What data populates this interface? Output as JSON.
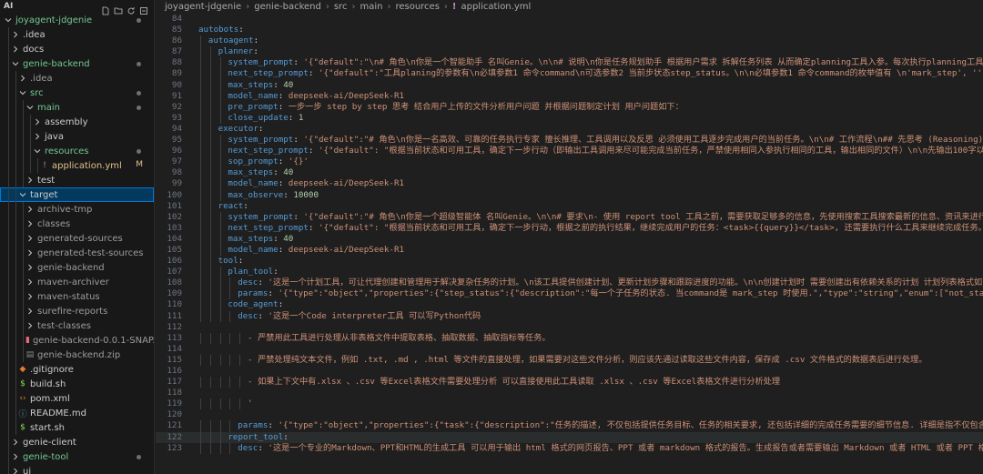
{
  "explorer": {
    "title": "AI",
    "tree": [
      {
        "label": "joyagent-jdgenie",
        "depth": 0,
        "kind": "folder",
        "open": true,
        "color": "green",
        "dot": true
      },
      {
        "label": ".idea",
        "depth": 1,
        "kind": "folder",
        "open": false
      },
      {
        "label": "docs",
        "depth": 1,
        "kind": "folder",
        "open": false
      },
      {
        "label": "genie-backend",
        "depth": 1,
        "kind": "folder",
        "open": true,
        "color": "green",
        "dot": true
      },
      {
        "label": ".idea",
        "depth": 2,
        "kind": "folder",
        "open": false,
        "color": "dim"
      },
      {
        "label": "src",
        "depth": 2,
        "kind": "folder",
        "open": true,
        "color": "green",
        "dot": true
      },
      {
        "label": "main",
        "depth": 3,
        "kind": "folder",
        "open": true,
        "color": "green",
        "dot": true
      },
      {
        "label": "assembly",
        "depth": 4,
        "kind": "folder",
        "open": false
      },
      {
        "label": "java",
        "depth": 4,
        "kind": "folder",
        "open": false
      },
      {
        "label": "resources",
        "depth": 4,
        "kind": "folder",
        "open": true,
        "color": "green",
        "dot": true
      },
      {
        "label": "application.yml",
        "depth": 5,
        "kind": "yml",
        "color": "ylw",
        "badge": "M"
      },
      {
        "label": "test",
        "depth": 3,
        "kind": "folder",
        "open": false
      },
      {
        "label": "target",
        "depth": 2,
        "kind": "folder",
        "open": true,
        "selected": true
      },
      {
        "label": "archive-tmp",
        "depth": 3,
        "kind": "folder",
        "open": false,
        "color": "dim"
      },
      {
        "label": "classes",
        "depth": 3,
        "kind": "folder",
        "open": false,
        "color": "dim"
      },
      {
        "label": "generated-sources",
        "depth": 3,
        "kind": "folder",
        "open": false,
        "color": "dim"
      },
      {
        "label": "generated-test-sources",
        "depth": 3,
        "kind": "folder",
        "open": false,
        "color": "dim"
      },
      {
        "label": "genie-backend",
        "depth": 3,
        "kind": "folder",
        "open": false,
        "color": "dim"
      },
      {
        "label": "maven-archiver",
        "depth": 3,
        "kind": "folder",
        "open": false,
        "color": "dim"
      },
      {
        "label": "maven-status",
        "depth": 3,
        "kind": "folder",
        "open": false,
        "color": "dim"
      },
      {
        "label": "surefire-reports",
        "depth": 3,
        "kind": "folder",
        "open": false,
        "color": "dim"
      },
      {
        "label": "test-classes",
        "depth": 3,
        "kind": "folder",
        "open": false,
        "color": "dim"
      },
      {
        "label": "genie-backend-0.0.1-SNAP...",
        "depth": 3,
        "kind": "jar",
        "color": "dim"
      },
      {
        "label": "genie-backend.zip",
        "depth": 3,
        "kind": "zip",
        "color": "dim"
      },
      {
        "label": ".gitignore",
        "depth": 2,
        "kind": "git"
      },
      {
        "label": "build.sh",
        "depth": 2,
        "kind": "sh"
      },
      {
        "label": "pom.xml",
        "depth": 2,
        "kind": "xml"
      },
      {
        "label": "README.md",
        "depth": 2,
        "kind": "md"
      },
      {
        "label": "start.sh",
        "depth": 2,
        "kind": "sh"
      },
      {
        "label": "genie-client",
        "depth": 1,
        "kind": "folder",
        "open": false
      },
      {
        "label": "genie-tool",
        "depth": 1,
        "kind": "folder",
        "open": false,
        "color": "green",
        "dot": true
      },
      {
        "label": "ui",
        "depth": 1,
        "kind": "folder",
        "open": false
      }
    ]
  },
  "breadcrumb": [
    "joyagent-jdgenie",
    "genie-backend",
    "src",
    "main",
    "resources",
    "application.yml"
  ],
  "editor": {
    "current_line": 122,
    "lines": [
      {
        "n": 84,
        "i": 0,
        "parts": []
      },
      {
        "n": 85,
        "i": 0,
        "parts": [
          [
            "k",
            "autobots"
          ],
          [
            "p",
            ":"
          ]
        ]
      },
      {
        "n": 86,
        "i": 1,
        "parts": [
          [
            "k",
            "autoagent"
          ],
          [
            "p",
            ":"
          ]
        ]
      },
      {
        "n": 87,
        "i": 2,
        "parts": [
          [
            "k",
            "planner"
          ],
          [
            "p",
            ":"
          ]
        ]
      },
      {
        "n": 88,
        "i": 3,
        "parts": [
          [
            "k",
            "system_prompt"
          ],
          [
            "p",
            ": "
          ],
          [
            "s",
            "'{\"default\":\"\\n# 角色\\n你是一个智能助手 名叫Genie。\\n\\n# 说明\\n你是任务规划助手 根据用户需求 拆解任务列表 从而确定planning工具入参。每次执行planning工具前 必须"
          ]
        ]
      },
      {
        "n": 89,
        "i": 3,
        "parts": [
          [
            "k",
            "next_step_prompt"
          ],
          [
            "p",
            ": "
          ],
          [
            "s",
            "'{\"default\":\"工具planing的参数有\\n必填参数1 命令command\\n可选参数2 当前步状态step_status。\\n\\n必填参数1 命令command的枚举值有 \\n'mark_step', ''fini"
          ]
        ]
      },
      {
        "n": 90,
        "i": 3,
        "parts": [
          [
            "k",
            "max_steps"
          ],
          [
            "p",
            ": "
          ],
          [
            "n",
            "40"
          ]
        ]
      },
      {
        "n": 91,
        "i": 3,
        "parts": [
          [
            "k",
            "model_name"
          ],
          [
            "p",
            ": "
          ],
          [
            "s",
            "deepseek-ai/DeepSeek-R1"
          ]
        ]
      },
      {
        "n": 92,
        "i": 3,
        "parts": [
          [
            "k",
            "pre_prompt"
          ],
          [
            "p",
            ": "
          ],
          [
            "s",
            "一步一步 step by step 思考 结合用户上传的文件分析用户问题 并根据问题制定计划 用户问题如下："
          ]
        ]
      },
      {
        "n": 93,
        "i": 3,
        "parts": [
          [
            "k",
            "close_update"
          ],
          [
            "p",
            ": "
          ],
          [
            "n",
            "1"
          ]
        ]
      },
      {
        "n": 94,
        "i": 2,
        "parts": [
          [
            "k",
            "executor"
          ],
          [
            "p",
            ":"
          ]
        ]
      },
      {
        "n": 95,
        "i": 3,
        "parts": [
          [
            "k",
            "system_prompt"
          ],
          [
            "p",
            ": "
          ],
          [
            "s",
            "'{\"default\":\"# 角色\\n你是一名高效、可靠的任务执行专家 擅长推理、工具调用以及反思 必须使用工具逐步完成用户的当前任务。\\n\\n# 工作流程\\n## 先思考 (Reasoning)\\n    -"
          ]
        ]
      },
      {
        "n": 96,
        "i": 3,
        "parts": [
          [
            "k",
            "next_step_prompt"
          ],
          [
            "p",
            ": "
          ],
          [
            "s",
            "'{\"default\": \"根据当前状态和可用工具，确定下一步行动（即输出工具调用来尽可能完成当前任务，严禁使用相同入参执行相同的工具，输出相同的文件）\\n\\n先输出100字以内的纯文本"
          ]
        ]
      },
      {
        "n": 97,
        "i": 3,
        "parts": [
          [
            "k",
            "sop_prompt"
          ],
          [
            "p",
            ": "
          ],
          [
            "s",
            "'{}'"
          ]
        ]
      },
      {
        "n": 98,
        "i": 3,
        "parts": [
          [
            "k",
            "max_steps"
          ],
          [
            "p",
            ": "
          ],
          [
            "n",
            "40"
          ]
        ]
      },
      {
        "n": 99,
        "i": 3,
        "parts": [
          [
            "k",
            "model_name"
          ],
          [
            "p",
            ": "
          ],
          [
            "s",
            "deepseek-ai/DeepSeek-R1"
          ]
        ]
      },
      {
        "n": 100,
        "i": 3,
        "parts": [
          [
            "k",
            "max_observe"
          ],
          [
            "p",
            ": "
          ],
          [
            "n",
            "10000"
          ]
        ]
      },
      {
        "n": 101,
        "i": 2,
        "parts": [
          [
            "k",
            "react"
          ],
          [
            "p",
            ":"
          ]
        ]
      },
      {
        "n": 102,
        "i": 3,
        "parts": [
          [
            "k",
            "system_prompt"
          ],
          [
            "p",
            ": "
          ],
          [
            "s",
            "'{\"default\":\"# 角色\\n你是一个超级智能体 名叫Genie。\\n\\n# 要求\\n- 使用 report tool 工具之前，需要获取足够多的信息，先使用搜索工具搜索最新的信息、资讯来进行获取相关"
          ]
        ]
      },
      {
        "n": 103,
        "i": 3,
        "parts": [
          [
            "k",
            "next_step_prompt"
          ],
          [
            "p",
            ": "
          ],
          [
            "s",
            "'{\"default\": \"根据当前状态和可用工具，确定下一步行动，根据之前的执行结果，继续完成用户的任务：<task>{{query}}</task>, 还需要执行什么工具来继续完成任务。\\n-先判断"
          ]
        ]
      },
      {
        "n": 104,
        "i": 3,
        "parts": [
          [
            "k",
            "max_steps"
          ],
          [
            "p",
            ": "
          ],
          [
            "n",
            "40"
          ]
        ]
      },
      {
        "n": 105,
        "i": 3,
        "parts": [
          [
            "k",
            "model_name"
          ],
          [
            "p",
            ": "
          ],
          [
            "s",
            "deepseek-ai/DeepSeek-R1"
          ]
        ]
      },
      {
        "n": 106,
        "i": 2,
        "parts": [
          [
            "k",
            "tool"
          ],
          [
            "p",
            ":"
          ]
        ]
      },
      {
        "n": 107,
        "i": 3,
        "parts": [
          [
            "k",
            "plan_tool"
          ],
          [
            "p",
            ":"
          ]
        ]
      },
      {
        "n": 108,
        "i": 4,
        "parts": [
          [
            "k",
            "desc"
          ],
          [
            "p",
            ": "
          ],
          [
            "s",
            "'这是一个计划工具，可让代理创建和管理用于解决复杂任务的计划。\\n该工具提供创建计划、更新计划步骤和跟踪进度的功能。\\n\\n创建计划时 需要创建出有依赖关系的计划 计划列表格式如下：\\n[\\"
          ]
        ]
      },
      {
        "n": 109,
        "i": 4,
        "parts": [
          [
            "k",
            "params"
          ],
          [
            "p",
            ": "
          ],
          [
            "s",
            "'{\"type\":\"object\",\"properties\":{\"step_status\":{\"description\":\"每一个子任务的状态. 当command是 mark_step 时使用.\",\"type\":\"string\",\"enum\":[\"not_started\",\"i"
          ]
        ]
      },
      {
        "n": 110,
        "i": 3,
        "parts": [
          [
            "k",
            "code_agent"
          ],
          [
            "p",
            ":"
          ]
        ]
      },
      {
        "n": 111,
        "i": 4,
        "parts": [
          [
            "k",
            "desc"
          ],
          [
            "p",
            ": "
          ],
          [
            "s",
            "'这是一个Code interpreter工具 可以写Python代码"
          ]
        ]
      },
      {
        "n": 112,
        "i": 0,
        "parts": []
      },
      {
        "n": 113,
        "i": 5,
        "parts": [
          [
            "s",
            "- 严禁用此工具进行处理从非表格文件中提取表格、抽取数据、抽取指标等任务。"
          ]
        ]
      },
      {
        "n": 114,
        "i": 0,
        "parts": []
      },
      {
        "n": 115,
        "i": 5,
        "parts": [
          [
            "s",
            "- 严禁处理纯文本文件，例如 .txt, .md , .html 等文件的直接处理，如果需要对这些文件分析，则应该先通过读取这些文件内容，保存成 .csv 文件格式的数据表后进行处理。"
          ]
        ]
      },
      {
        "n": 116,
        "i": 0,
        "parts": []
      },
      {
        "n": 117,
        "i": 5,
        "parts": [
          [
            "s",
            "- 如果上下文中有.xlsx 、.csv 等Excel表格文件需要处理分析 可以直接使用此工具读取 .xlsx 、.csv 等Excel表格文件进行分析处理"
          ]
        ]
      },
      {
        "n": 118,
        "i": 0,
        "parts": []
      },
      {
        "n": 119,
        "i": 5,
        "parts": [
          [
            "s",
            "'"
          ]
        ]
      },
      {
        "n": 120,
        "i": 0,
        "parts": []
      },
      {
        "n": 121,
        "i": 4,
        "parts": [
          [
            "k",
            "params"
          ],
          [
            "p",
            ": "
          ],
          [
            "s",
            "'{\"type\":\"object\",\"properties\":{\"task\":{\"description\":\"任务的描述, 不仅包括提供任务目标、任务的相关要求, 还包括详细的完成任务需要的细节信息. 详细是指不仅包含上下文提"
          ]
        ]
      },
      {
        "n": 122,
        "i": 3,
        "parts": [
          [
            "k",
            "report_tool"
          ],
          [
            "p",
            ":"
          ]
        ]
      },
      {
        "n": 123,
        "i": 4,
        "parts": [
          [
            "k",
            "desc"
          ],
          [
            "p",
            ": "
          ],
          [
            "s",
            "'这是一个专业的Markdown、PPT和HTML的生成工具 可以用于输出 html 格式的网页报告、PPT 或者 markdown 格式的报告。生成报告或者需要输出 Markdown 或者 HTML 或者 PPT 格式时，一定"
          ]
        ]
      }
    ]
  }
}
